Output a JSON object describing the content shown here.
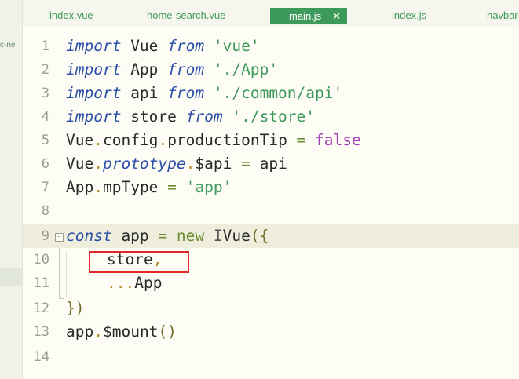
{
  "sidebar": {
    "fragment": "c-ne"
  },
  "tabs": [
    {
      "label": "index.vue",
      "active": false
    },
    {
      "label": "home-search.vue",
      "active": false
    },
    {
      "label": "main.js",
      "active": true,
      "close": "✕"
    },
    {
      "label": "index.js",
      "active": false
    },
    {
      "label": "navbar",
      "active": false
    }
  ],
  "colors": {
    "accent": "#3e9a5a",
    "keyword": "#2b4fa8",
    "string": "#3e9a5a",
    "boolean": "#a23fb5",
    "highlight_line": "#efeedd",
    "annotation": "#e0282a"
  },
  "editor": {
    "line_numbers": [
      "1",
      "2",
      "3",
      "4",
      "5",
      "6",
      "7",
      "8",
      "9",
      "10",
      "11",
      "12",
      "13",
      "14"
    ],
    "highlighted_line": 9,
    "annotation": {
      "line": 10,
      "text": "store,"
    },
    "lines": {
      "l1": {
        "kw1": "import",
        "id": " Vue ",
        "kw2": "from",
        "sp": " ",
        "str": "'vue'"
      },
      "l2": {
        "kw1": "import",
        "id": " App ",
        "kw2": "from",
        "sp": " ",
        "str": "'./App'"
      },
      "l3": {
        "kw1": "import",
        "id": " api ",
        "kw2": "from",
        "sp": " ",
        "str": "'./common/api'"
      },
      "l4": {
        "kw1": "import",
        "id": " store ",
        "kw2": "from",
        "sp": " ",
        "str": "'./store'"
      },
      "l5": {
        "a": "Vue",
        "d1": ".",
        "b": "config",
        "d2": ".",
        "c": "productionTip",
        "eq": " = ",
        "val": "false"
      },
      "l6": {
        "a": "Vue",
        "d1": ".",
        "b": "prototype",
        "d2": ".",
        "c": "$api",
        "eq": " = ",
        "val": "api"
      },
      "l7": {
        "a": "App",
        "d1": ".",
        "c": "mpType",
        "eq": " = ",
        "val": "'app'"
      },
      "l9": {
        "kw": "const",
        "id": " app ",
        "eq": "=",
        "sp": " ",
        "nw": "new",
        "sp2": " ",
        "cur": "I",
        "cls": "Vue",
        "p": "(",
        "b": "{"
      },
      "l10": {
        "text": "store",
        "comma": ","
      },
      "l11": {
        "spread": "...",
        "text": "App"
      },
      "l12": {
        "b": "}",
        "p": ")"
      },
      "l13": {
        "a": "app",
        "d": ".",
        "c": "$mount",
        "p": "()"
      }
    }
  }
}
